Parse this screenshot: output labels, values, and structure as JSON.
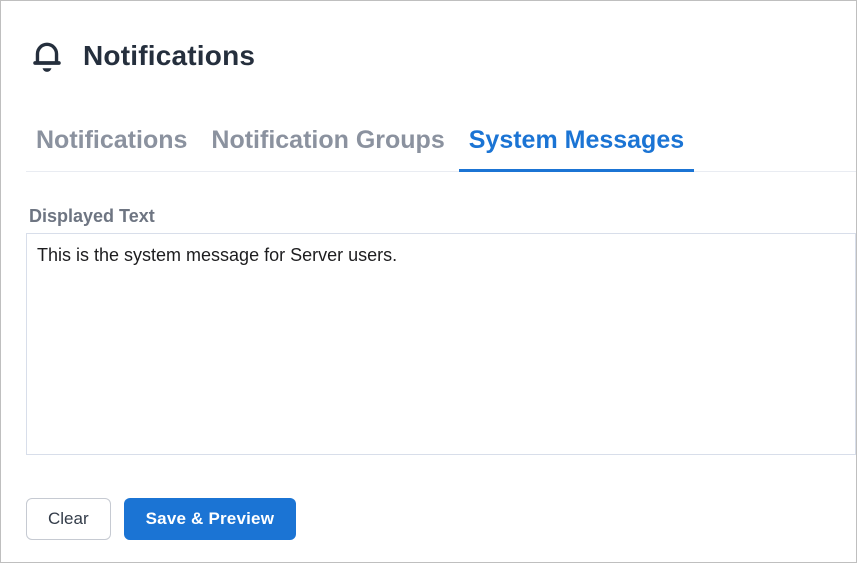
{
  "header": {
    "title": "Notifications",
    "icon": "bell-icon"
  },
  "tabs": [
    {
      "label": "Notifications",
      "active": false
    },
    {
      "label": "Notification Groups",
      "active": false
    },
    {
      "label": "System Messages",
      "active": true
    }
  ],
  "form": {
    "label": "Displayed Text",
    "textarea_value": "This is the system message for Server users."
  },
  "buttons": {
    "clear_label": "Clear",
    "save_label": "Save & Preview"
  },
  "colors": {
    "accent_blue": "#1b74d4",
    "title_dark": "#252f3d",
    "inactive_tab_gray": "#8b929f",
    "label_gray": "#6e7582",
    "textarea_border": "#d8deea",
    "tabbar_border": "#e9ecf2",
    "frame_border": "#bfbfbf"
  }
}
